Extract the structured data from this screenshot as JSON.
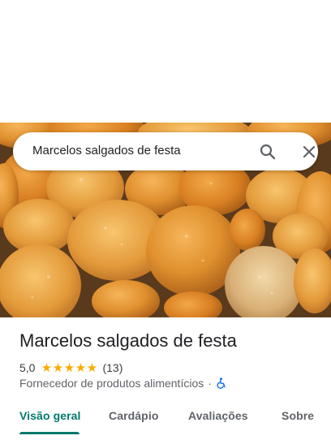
{
  "search": {
    "query": "Marcelos salgados de festa",
    "search_icon": "search-icon",
    "close_icon": "close-icon"
  },
  "place": {
    "name": "Marcelos salgados de festa",
    "rating": "5,0",
    "stars": 5,
    "review_count": "(13)",
    "category": "Fornecedor de produtos alimentícios",
    "separator": "·",
    "accessibility_icon": "wheelchair-icon"
  },
  "tabs": [
    {
      "label": "Visão geral",
      "active": true
    },
    {
      "label": "Cardápio",
      "active": false
    },
    {
      "label": "Avaliações",
      "active": false
    },
    {
      "label": "Sobre",
      "active": false
    }
  ],
  "colors": {
    "accent": "#00796b",
    "star": "#f9ab00",
    "accessibility": "#1a73e8"
  }
}
